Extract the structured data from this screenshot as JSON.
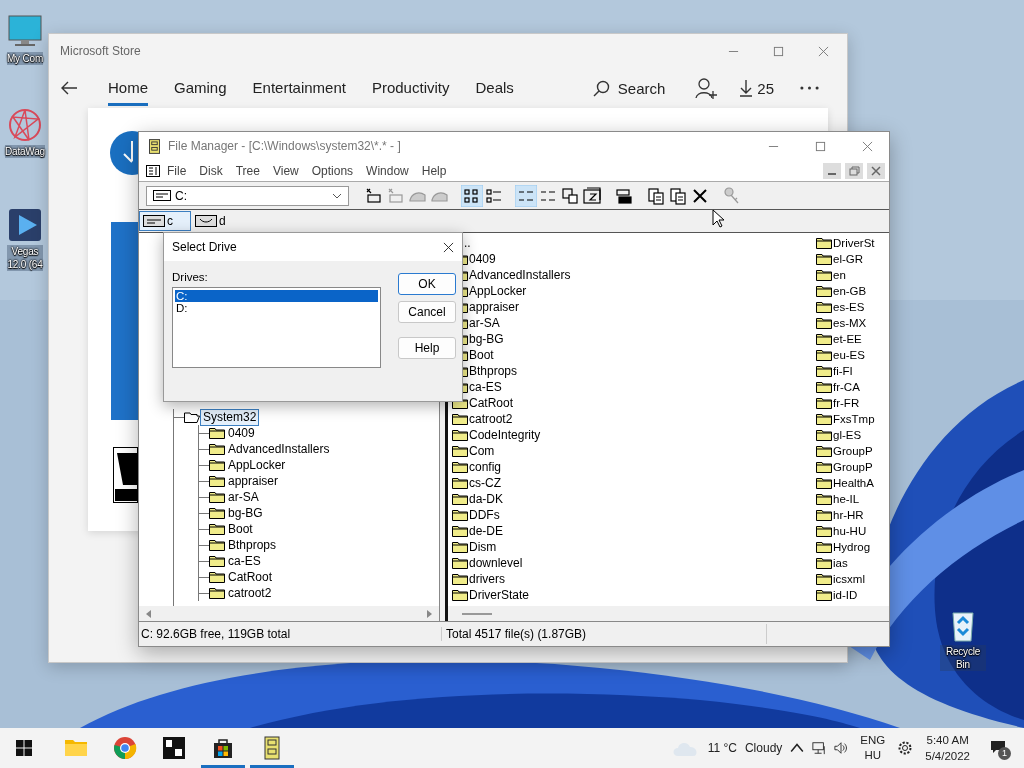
{
  "desktop_icons": [
    {
      "kind": "computer",
      "label_lines": [
        "My Com"
      ]
    },
    {
      "kind": "app",
      "label_lines": [
        "DataWag"
      ]
    },
    {
      "kind": "video",
      "label_lines": [
        "Vegas",
        "12.0 (64"
      ]
    },
    {
      "kind": "recycle",
      "label_lines": [
        "Recycle Bin"
      ]
    }
  ],
  "store": {
    "title": "Microsoft Store",
    "tabs": [
      {
        "label": "Home",
        "selected": true
      },
      {
        "label": "Gaming",
        "selected": false
      },
      {
        "label": "Entertainment",
        "selected": false
      },
      {
        "label": "Productivity",
        "selected": false
      },
      {
        "label": "Deals",
        "selected": false
      }
    ],
    "search": "Search",
    "downloads": "25"
  },
  "file_manager": {
    "title": "File Manager - [C:\\Windows\\system32\\*.* - ]",
    "menu": [
      "File",
      "Disk",
      "Tree",
      "View",
      "Options",
      "Window",
      "Help"
    ],
    "drive_combo": "C:",
    "toolbar": [
      {
        "kind": "connect",
        "pressed": false,
        "disabled": false
      },
      {
        "kind": "disconnect",
        "pressed": false,
        "disabled": true
      },
      {
        "kind": "share",
        "pressed": false,
        "disabled": true
      },
      {
        "kind": "unshare",
        "pressed": false,
        "disabled": true
      },
      {
        "kind": "icons",
        "pressed": true,
        "disabled": false
      },
      {
        "kind": "details",
        "pressed": false,
        "disabled": false
      },
      {
        "kind": "sort-name",
        "pressed": true,
        "disabled": false
      },
      {
        "kind": "sort-type",
        "pressed": false,
        "disabled": false
      },
      {
        "kind": "windows",
        "pressed": false,
        "disabled": false
      },
      {
        "kind": "archive",
        "pressed": false,
        "disabled": false
      },
      {
        "kind": "split",
        "pressed": false,
        "disabled": false
      },
      {
        "kind": "copy",
        "pressed": false,
        "disabled": false
      },
      {
        "kind": "move",
        "pressed": false,
        "disabled": false
      },
      {
        "kind": "delete",
        "pressed": false,
        "disabled": false
      },
      {
        "kind": "key",
        "pressed": false,
        "disabled": true
      }
    ],
    "drives": [
      {
        "label": "c",
        "selected": true
      },
      {
        "label": "d",
        "selected": false
      }
    ],
    "tree": [
      {
        "name": "System32",
        "selected": true,
        "open": true,
        "children": [
          {
            "name": "0409",
            "selected": false
          },
          {
            "name": "AdvancedInstallers",
            "selected": false
          },
          {
            "name": "AppLocker",
            "selected": false
          },
          {
            "name": "appraiser",
            "selected": false
          },
          {
            "name": "ar-SA",
            "selected": false
          },
          {
            "name": "bg-BG",
            "selected": false
          },
          {
            "name": "Boot",
            "selected": false
          },
          {
            "name": "Bthprops",
            "selected": false
          },
          {
            "name": "ca-ES",
            "selected": false
          },
          {
            "name": "CatRoot",
            "selected": false
          },
          {
            "name": "catroot2",
            "selected": false
          }
        ]
      }
    ],
    "files": {
      "parent_entry": "..",
      "columns": [
        [
          "0409",
          "AdvancedInstallers",
          "AppLocker",
          "appraiser",
          "ar-SA",
          "bg-BG",
          "Boot",
          "Bthprops",
          "ca-ES",
          "CatRoot",
          "catroot2",
          "CodeIntegrity",
          "Com",
          "config",
          "cs-CZ",
          "da-DK",
          "DDFs",
          "de-DE",
          "Dism",
          "downlevel",
          "drivers",
          "DriverState"
        ],
        [
          "DriverSt",
          "el-GR",
          "en",
          "en-GB",
          "es-ES",
          "es-MX",
          "et-EE",
          "eu-ES",
          "fi-FI",
          "fr-CA",
          "fr-FR",
          "FxsTmp",
          "gl-ES",
          "GroupP",
          "GroupP",
          "HealthA",
          "he-IL",
          "hr-HR",
          "hu-HU",
          "Hydrog",
          "ias",
          "icsxml",
          "id-ID"
        ]
      ]
    },
    "status": {
      "left": "C: 92.6GB free,  119GB total",
      "right": "Total 4517 file(s) (1.87GB)"
    }
  },
  "dialog": {
    "title": "Select Drive",
    "list_label": "Drives:",
    "drives": [
      {
        "label": "C:",
        "selected": true
      },
      {
        "label": "D:",
        "selected": false
      }
    ],
    "buttons": [
      {
        "label": "OK",
        "default": true
      },
      {
        "label": "Cancel",
        "default": false
      },
      {
        "label": "Help",
        "default": false
      }
    ]
  },
  "taskbar": {
    "apps": [
      {
        "kind": "explorer",
        "running": false
      },
      {
        "kind": "chrome",
        "running": false
      },
      {
        "kind": "di",
        "running": false
      },
      {
        "kind": "store",
        "running": true
      },
      {
        "kind": "filemanager",
        "running": true
      }
    ],
    "temperature": "11 °C",
    "weather": "Cloudy",
    "language": [
      "ENG",
      "HU"
    ],
    "time": "5:40 AM",
    "date": "5/4/2022",
    "notifications": "1"
  }
}
